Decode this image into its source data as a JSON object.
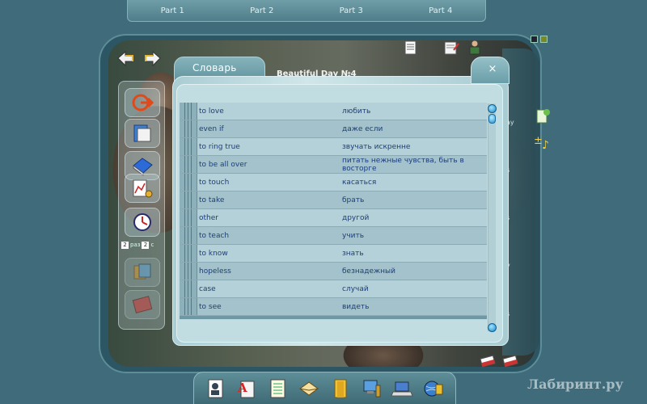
{
  "top_tabs": [
    "Part 1",
    "Part 2",
    "Part 3",
    "Part 4"
  ],
  "dictionary": {
    "tab_label": "Словарь",
    "lesson_title": "Beautiful Day №4",
    "close_label": "×",
    "rows": [
      {
        "en": "to love",
        "ru": "любить"
      },
      {
        "en": "even if",
        "ru": "даже если"
      },
      {
        "en": "to ring true",
        "ru": "звучать искренне"
      },
      {
        "en": "to be all over",
        "ru": "питать нежные чувства, быть в восторге"
      },
      {
        "en": "to touch",
        "ru": "касаться"
      },
      {
        "en": "to take",
        "ru": "брать"
      },
      {
        "en": "other",
        "ru": "другой"
      },
      {
        "en": "to teach",
        "ru": "учить"
      },
      {
        "en": "to know",
        "ru": "знать"
      },
      {
        "en": "hopeless",
        "ru": "безнадежный"
      },
      {
        "en": "case",
        "ru": "случай"
      },
      {
        "en": "to see",
        "ru": "видеть"
      }
    ]
  },
  "left_toolbar": {
    "counter": {
      "current": "2",
      "sep": "раз",
      "total": "2",
      "suffix": "с"
    }
  },
  "right_side_text": [
    "ay",
    "s",
    "s",
    "y",
    "s"
  ],
  "bottom_toolbar_icons": [
    "user-card-icon",
    "abc-book-icon",
    "notes-icon",
    "envelope-icon",
    "folder-icon",
    "computer-icon",
    "laptop-icon",
    "globe-icon"
  ],
  "watermark": "Лабиринт.ру",
  "colors": {
    "background": "#3f6b7b",
    "row_text": "#1c3e7e",
    "scroll_button": "#1f86c8"
  }
}
